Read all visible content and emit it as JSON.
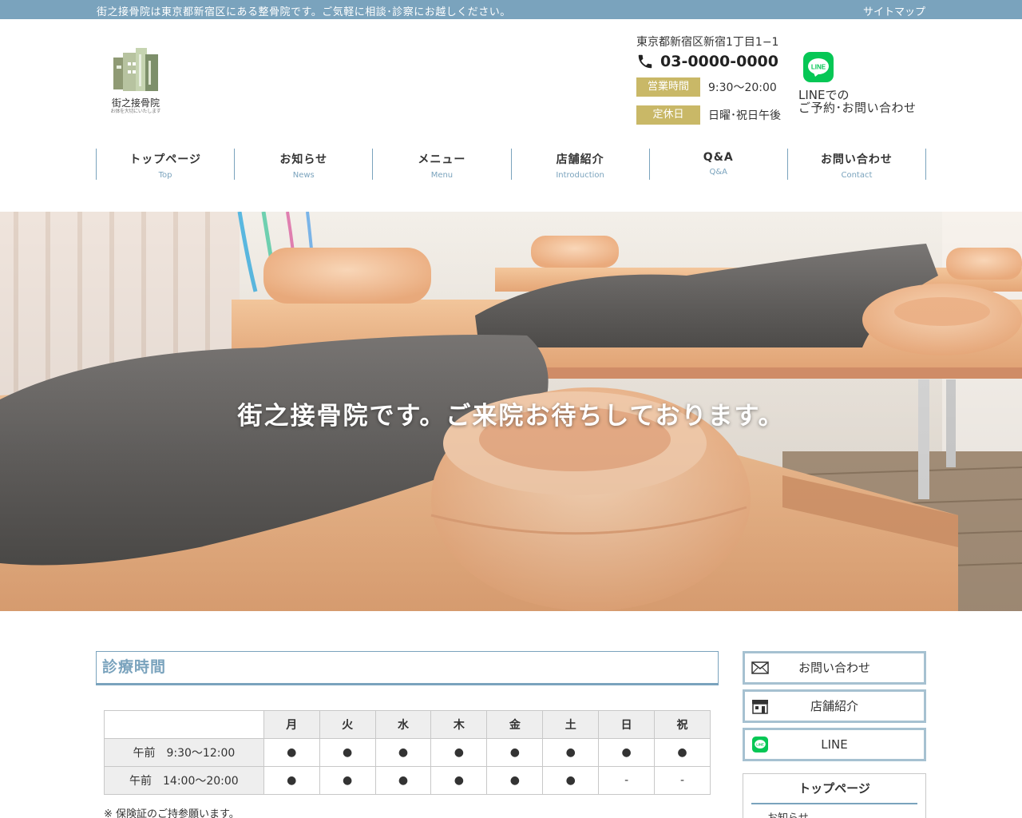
{
  "colors": {
    "accent": "#7aa3bd",
    "gold": "#c9b867",
    "line_green": "#06c755"
  },
  "topbar": {
    "tagline": "街之接骨院は東京都新宿区にある整骨院です。ご気軽に相談･診察にお越しください。",
    "sitemap": "サイトマップ"
  },
  "logo": {
    "name": "街之接骨院",
    "sub": "お体を大切にいたします"
  },
  "header": {
    "address": "東京都新宿区新宿1丁目1−1",
    "phone": "03-0000-0000",
    "hours_label": "営業時間",
    "hours_value": "9:30〜20:00",
    "closed_label": "定休日",
    "closed_value": "日曜･祝日午後",
    "line_text1": "LINEでの",
    "line_text2": "ご予約･お問い合わせ",
    "line_icon_text": "LINE"
  },
  "nav": [
    {
      "jp": "トップページ",
      "en": "Top"
    },
    {
      "jp": "お知らせ",
      "en": "News"
    },
    {
      "jp": "メニュー",
      "en": "Menu"
    },
    {
      "jp": "店舗紹介",
      "en": "Introduction"
    },
    {
      "jp": "Q&A",
      "en": "Q&A"
    },
    {
      "jp": "お問い合わせ",
      "en": "Contact"
    }
  ],
  "hero": {
    "catch": "街之接骨院です。ご来院お待ちしております。"
  },
  "schedule": {
    "title": "診療時間",
    "days": [
      "月",
      "火",
      "水",
      "木",
      "金",
      "土",
      "日",
      "祝"
    ],
    "rows": [
      {
        "label": "午前　9:30～12:00",
        "cells": [
          "●",
          "●",
          "●",
          "●",
          "●",
          "●",
          "●",
          "●"
        ]
      },
      {
        "label": "午前　14:00～20:00",
        "cells": [
          "●",
          "●",
          "●",
          "●",
          "●",
          "●",
          "-",
          "-"
        ]
      }
    ],
    "note": "※ 保険証のご持参願います。"
  },
  "sidebar": {
    "contact": "お問い合わせ",
    "store": "店舗紹介",
    "line": "LINE",
    "menu_head": "トップページ",
    "menu_sub": "お知らせ"
  }
}
